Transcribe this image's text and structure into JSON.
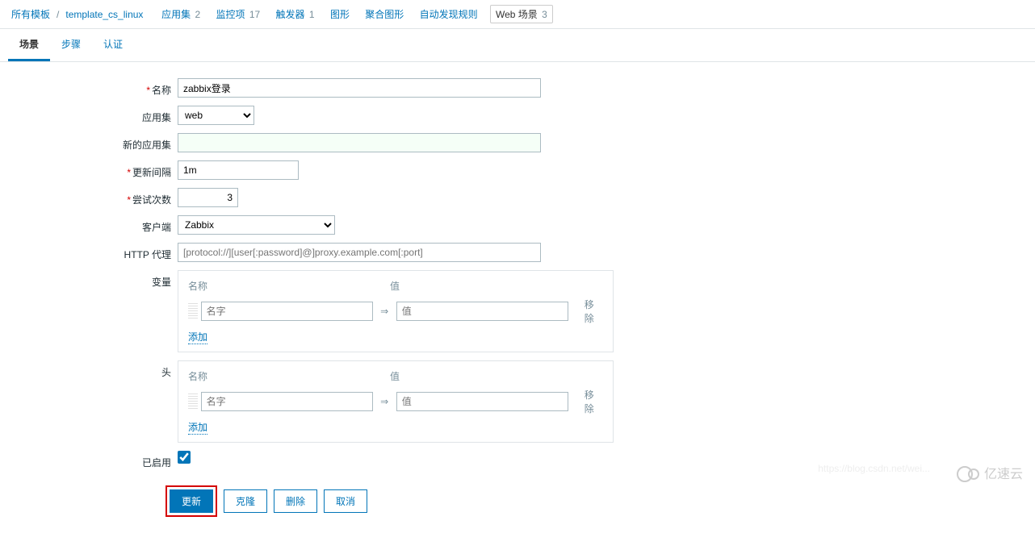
{
  "breadcrumb": {
    "all_templates": "所有模板",
    "template_name": "template_cs_linux",
    "items": [
      {
        "label": "应用集",
        "count": "2"
      },
      {
        "label": "监控项",
        "count": "17"
      },
      {
        "label": "触发器",
        "count": "1"
      },
      {
        "label": "图形",
        "count": ""
      },
      {
        "label": "聚合图形",
        "count": ""
      },
      {
        "label": "自动发现规则",
        "count": ""
      }
    ],
    "current": {
      "label": "Web 场景",
      "count": "3"
    }
  },
  "tabs": {
    "scenario": "场景",
    "steps": "步骤",
    "auth": "认证"
  },
  "form": {
    "name_label": "名称",
    "name_value": "zabbix登录",
    "app_label": "应用集",
    "app_value": "web",
    "newapp_label": "新的应用集",
    "newapp_value": "",
    "interval_label": "更新间隔",
    "interval_value": "1m",
    "attempts_label": "尝试次数",
    "attempts_value": "3",
    "agent_label": "客户端",
    "agent_value": "Zabbix",
    "proxy_label": "HTTP 代理",
    "proxy_placeholder": "[protocol://][user[:password]@]proxy.example.com[:port]",
    "vars_label": "变量",
    "headers_label": "头",
    "col_name": "名称",
    "col_value": "值",
    "name_placeholder": "名字",
    "value_placeholder": "值",
    "remove": "移除",
    "add": "添加",
    "enabled_label": "已启用"
  },
  "buttons": {
    "update": "更新",
    "clone": "克隆",
    "delete": "删除",
    "cancel": "取消"
  },
  "watermark": {
    "url": "https://blog.csdn.net/wei...",
    "brand": "亿速云"
  }
}
